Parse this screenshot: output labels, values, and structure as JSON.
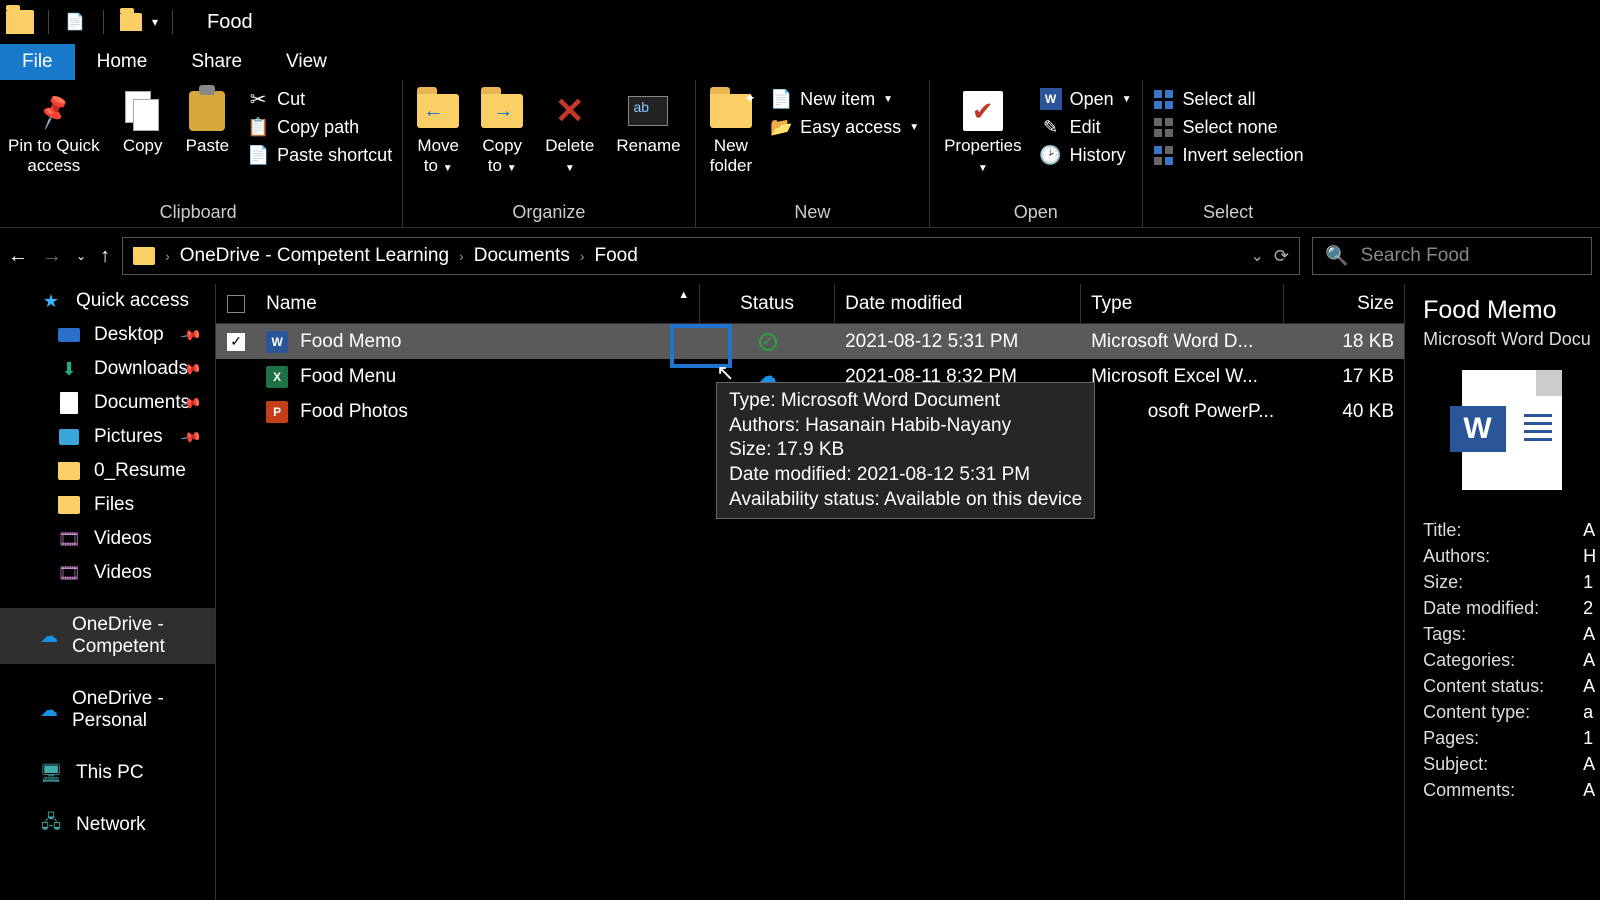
{
  "title": "Food",
  "tabs": {
    "file": "File",
    "home": "Home",
    "share": "Share",
    "view": "View"
  },
  "ribbon": {
    "pin": "Pin to Quick\naccess",
    "copy": "Copy",
    "paste": "Paste",
    "cut": "Cut",
    "copy_path": "Copy path",
    "paste_shortcut": "Paste shortcut",
    "clipboard": "Clipboard",
    "move_to": "Move\nto",
    "copy_to": "Copy\nto",
    "delete": "Delete",
    "rename": "Rename",
    "organize": "Organize",
    "new_folder": "New\nfolder",
    "new_item": "New item",
    "easy_access": "Easy access",
    "new": "New",
    "properties": "Properties",
    "open": "Open",
    "edit": "Edit",
    "history": "History",
    "open_group": "Open",
    "select_all": "Select all",
    "select_none": "Select none",
    "invert": "Invert selection",
    "select": "Select"
  },
  "breadcrumb": [
    "OneDrive - Competent Learning",
    "Documents",
    "Food"
  ],
  "search_placeholder": "Search Food",
  "sidebar": {
    "quick_access": "Quick access",
    "desktop": "Desktop",
    "downloads": "Downloads",
    "documents": "Documents",
    "pictures": "Pictures",
    "resume": "0_Resume",
    "files": "Files",
    "videos1": "Videos",
    "videos2": "Videos",
    "onedrive_c": "OneDrive - Competent",
    "onedrive_p": "OneDrive - Personal",
    "this_pc": "This PC",
    "network": "Network"
  },
  "columns": {
    "name": "Name",
    "status": "Status",
    "date": "Date modified",
    "type": "Type",
    "size": "Size"
  },
  "files": [
    {
      "name": "Food Memo",
      "date": "2021-08-12 5:31 PM",
      "type": "Microsoft Word D...",
      "size": "18 KB"
    },
    {
      "name": "Food Menu",
      "date": "2021-08-11 8:32 PM",
      "type": "Microsoft Excel W...",
      "size": "17 KB"
    },
    {
      "name": "Food Photos",
      "date": "",
      "type": "osoft PowerP...",
      "size": "40 KB"
    }
  ],
  "tooltip": {
    "type": "Type: Microsoft Word Document",
    "authors": "Authors: Hasanain Habib-Nayany",
    "size": "Size: 17.9 KB",
    "date": "Date modified: 2021-08-12 5:31 PM",
    "avail": "Availability status: Available on this device"
  },
  "details": {
    "title": "Food Memo",
    "subtype": "Microsoft Word Docu",
    "props": {
      "Title": "A",
      "Authors": "H",
      "Size": "1",
      "Date_modified": "2",
      "Tags": "A",
      "Categories": "A",
      "Content_status": "A",
      "Content_type": "a",
      "Pages": "1",
      "Subject": "A",
      "Comments": "A"
    }
  }
}
